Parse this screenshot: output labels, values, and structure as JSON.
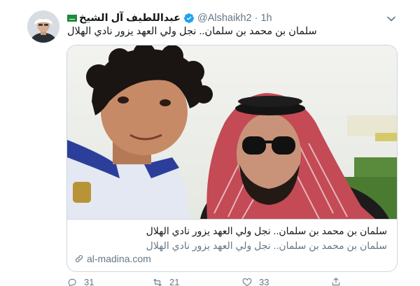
{
  "tweet": {
    "author_name": "عبداللطيف آل الشيخ",
    "handle": "@Alshaikh2",
    "separator": "·",
    "time": "1h",
    "text": "سلمان بن محمد بن سلمان.. نجل ولي العهد يزور نادي الهلال"
  },
  "card": {
    "title": "سلمان بن محمد بن سلمان.. نجل ولي العهد يزور نادي الهلال",
    "description": "سلمان بن محمد بن سلمان.. نجل ولي العهد يزور نادي الهلال",
    "domain": "al-madina.com"
  },
  "actions": {
    "replies": "31",
    "retweets": "21",
    "likes": "33"
  },
  "colors": {
    "verified": "#1da1f2",
    "muted": "#657786",
    "border": "#ccd6dd"
  }
}
